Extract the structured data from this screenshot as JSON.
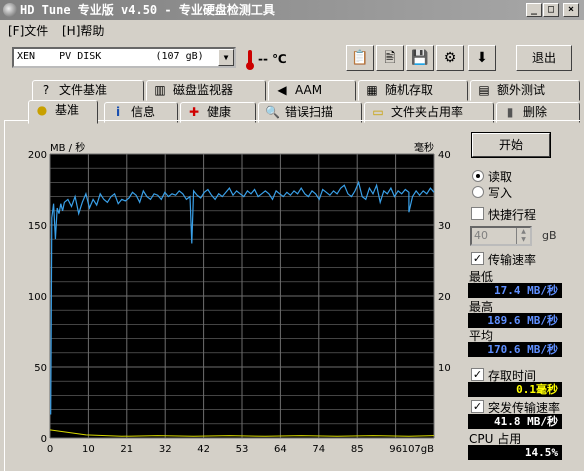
{
  "window": {
    "title": "HD Tune 专业版 v4.50 - 专业硬盘检测工具",
    "buttons": [
      "_",
      "□",
      "×"
    ]
  },
  "menu": [
    {
      "label": "[F]文件"
    },
    {
      "label": "[H]帮助"
    }
  ],
  "toolbar": {
    "drive": "XEN    PV DISK         (107 gB)",
    "temperature": "-- ℃",
    "buttons": [
      {
        "name": "copy-text-icon",
        "glyph": "📋"
      },
      {
        "name": "copy-image-icon",
        "glyph": "🖹"
      },
      {
        "name": "save-icon",
        "glyph": "💾"
      },
      {
        "name": "options-icon",
        "glyph": "⚙"
      },
      {
        "name": "download-icon",
        "glyph": "⬇"
      }
    ],
    "exit_label": "退出"
  },
  "tabs_row1": [
    {
      "label": "文件基准",
      "icon": "file-benchmark-icon",
      "glyph": "?"
    },
    {
      "label": "磁盘监视器",
      "icon": "disk-monitor-icon",
      "glyph": "▥"
    },
    {
      "label": "AAM",
      "icon": "speaker-icon",
      "glyph": "◀"
    },
    {
      "label": "随机存取",
      "icon": "random-access-icon",
      "glyph": "▦"
    },
    {
      "label": "额外测试",
      "icon": "extra-tests-icon",
      "glyph": "▤"
    }
  ],
  "tabs_row2": [
    {
      "label": "基准",
      "icon": "benchmark-icon",
      "glyph": "●",
      "active": true
    },
    {
      "label": "信息",
      "icon": "info-icon",
      "glyph": "i"
    },
    {
      "label": "健康",
      "icon": "health-icon",
      "glyph": "✚"
    },
    {
      "label": "错误扫描",
      "icon": "error-scan-icon",
      "glyph": "🔍"
    },
    {
      "label": "文件夹占用率",
      "icon": "folder-usage-icon",
      "glyph": "▭"
    },
    {
      "label": "删除",
      "icon": "trash-icon",
      "glyph": "▮"
    }
  ],
  "chart_data": {
    "type": "line",
    "left_axis_label": "MB / 秒",
    "right_axis_label": "毫秒",
    "y_ticks": [
      "200",
      "150",
      "100",
      "50",
      "0"
    ],
    "y_ticks_right": [
      "40",
      "30",
      "20",
      "10",
      ""
    ],
    "x_ticks": [
      "0",
      "10",
      "21",
      "32",
      "42",
      "53",
      "64",
      "74",
      "85",
      "96",
      "107gB"
    ],
    "ylim": [
      0,
      200
    ],
    "ylim_right": [
      0,
      40
    ],
    "xlim": [
      0,
      107
    ],
    "grid": true,
    "series": [
      {
        "color": "#3aa0e8",
        "x": [
          0,
          0.5,
          1,
          1.5,
          2,
          2.5,
          3,
          3.5,
          4,
          5,
          6,
          7,
          8,
          9,
          10,
          11,
          12,
          13,
          14,
          15,
          16,
          17,
          18,
          19,
          20,
          21,
          22,
          23,
          24,
          25,
          26,
          27,
          28,
          29,
          30,
          31,
          32,
          33,
          34,
          35,
          36,
          37,
          38,
          39,
          40,
          41,
          42,
          43,
          44,
          45,
          46,
          47,
          48,
          49,
          50,
          51,
          52,
          53,
          54,
          55,
          56,
          57,
          58,
          59,
          60,
          61,
          62,
          63,
          64,
          65,
          66,
          67,
          68,
          69,
          70,
          71,
          72,
          73,
          74,
          75,
          76,
          77,
          78,
          79,
          80,
          81,
          82,
          83,
          84,
          85,
          86,
          87,
          88,
          89,
          90,
          91,
          92,
          93,
          94,
          95,
          96,
          97,
          98,
          99,
          100,
          101,
          102,
          103,
          104,
          105,
          106,
          107
        ],
        "values": [
          17,
          155,
          165,
          140,
          162,
          158,
          165,
          160,
          166,
          168,
          163,
          170,
          158,
          166,
          172,
          162,
          168,
          164,
          172,
          168,
          166,
          170,
          172,
          165,
          168,
          167,
          169,
          173,
          171,
          166,
          174,
          170,
          168,
          172,
          171,
          168,
          173,
          170,
          172,
          171,
          174,
          172,
          168,
          170,
          174,
          171,
          169,
          173,
          175,
          171,
          168,
          172,
          170,
          173,
          176,
          171,
          174,
          172,
          170,
          174,
          172,
          175,
          170,
          172,
          174,
          172,
          168,
          174,
          172,
          170,
          173,
          171,
          174,
          172,
          176,
          172,
          170,
          174,
          172,
          168,
          175,
          173,
          171,
          174,
          172,
          176,
          178,
          172,
          170,
          174,
          180,
          170,
          168,
          176,
          172,
          178,
          166,
          174,
          172,
          176,
          170,
          174,
          172,
          175,
          173,
          170,
          174,
          171,
          174,
          172,
          176,
          173
        ]
      },
      {
        "color": "#d8d800",
        "x": [
          0,
          10,
          20,
          30,
          40,
          50,
          60,
          70,
          80,
          90,
          100,
          107
        ],
        "values": [
          1.0,
          0.3,
          0.1,
          0.2,
          0.1,
          0.2,
          0.1,
          0.2,
          0.1,
          0.2,
          0.1,
          0.2
        ]
      }
    ],
    "spikes": [
      {
        "x": 0.2,
        "y": 17
      },
      {
        "x": 39.5,
        "y": 137
      },
      {
        "x": 100,
        "y": 159
      }
    ]
  },
  "controls": {
    "start_label": "开始",
    "read_label": "读取",
    "write_label": "写入",
    "quick_label": "快捷行程",
    "quick_value": "40",
    "quick_unit": "gB",
    "transfer_label": "传输速率",
    "min_label": "最低",
    "min_value": "17.4 MB/秒",
    "max_label": "最高",
    "max_value": "189.6 MB/秒",
    "avg_label": "平均",
    "avg_value": "170.6 MB/秒",
    "access_label": "存取时间",
    "access_value": "0.1毫秒",
    "burst_label": "突发传输速率",
    "burst_value": "41.8 MB/秒",
    "cpu_label": "CPU 占用",
    "cpu_value": "14.5%"
  },
  "colors": {
    "graph_bg": "#000000",
    "grid": "#6e6e6e",
    "transfer_line": "#3aa0e8",
    "access_line": "#d8d800"
  }
}
